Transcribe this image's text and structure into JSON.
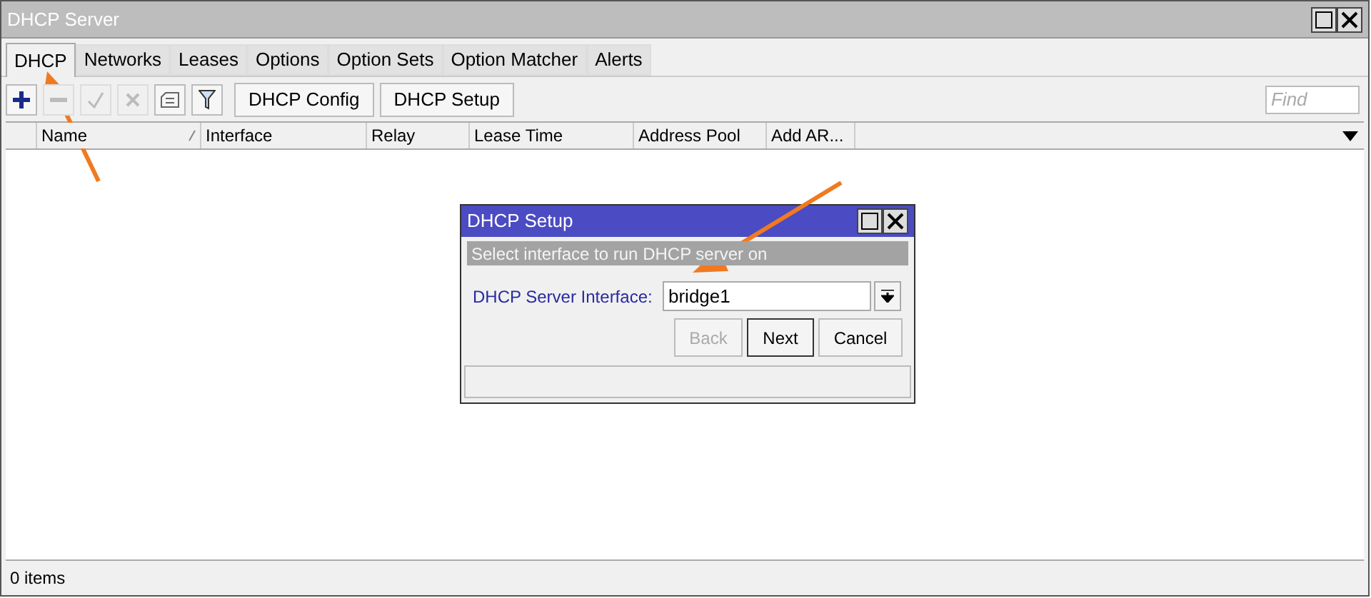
{
  "window": {
    "title": "DHCP Server"
  },
  "tabs": [
    {
      "label": "DHCP",
      "selected": true
    },
    {
      "label": "Networks",
      "selected": false
    },
    {
      "label": "Leases",
      "selected": false
    },
    {
      "label": "Options",
      "selected": false
    },
    {
      "label": "Option Sets",
      "selected": false
    },
    {
      "label": "Option Matcher",
      "selected": false
    },
    {
      "label": "Alerts",
      "selected": false
    }
  ],
  "toolbar": {
    "icon_buttons": [
      {
        "kind": "add",
        "disabled": false
      },
      {
        "kind": "remove",
        "disabled": true
      },
      {
        "kind": "enable",
        "disabled": true
      },
      {
        "kind": "disable",
        "disabled": true
      },
      {
        "kind": "comment",
        "disabled": false
      },
      {
        "kind": "filter",
        "disabled": false
      }
    ],
    "buttons": [
      "DHCP Config",
      "DHCP Setup"
    ],
    "search": {
      "placeholder": "Find"
    }
  },
  "table": {
    "columns": [
      {
        "label": "Name",
        "sorted": true
      },
      {
        "label": "Interface",
        "sorted": false
      },
      {
        "label": "Relay",
        "sorted": false
      },
      {
        "label": "Lease Time",
        "sorted": false
      },
      {
        "label": "Address Pool",
        "sorted": false
      },
      {
        "label": "Add AR...",
        "sorted": false
      }
    ]
  },
  "status_bar": "0 items",
  "dialog": {
    "title": "DHCP Setup",
    "banner": "Select interface to run DHCP server on",
    "field": {
      "label": "DHCP Server Interface:",
      "value": "bridge1"
    },
    "buttons": [
      {
        "label": "Back",
        "disabled": true,
        "selected": false
      },
      {
        "label": "Next",
        "disabled": false,
        "selected": true
      },
      {
        "label": "Cancel",
        "disabled": false,
        "selected": false
      }
    ]
  }
}
